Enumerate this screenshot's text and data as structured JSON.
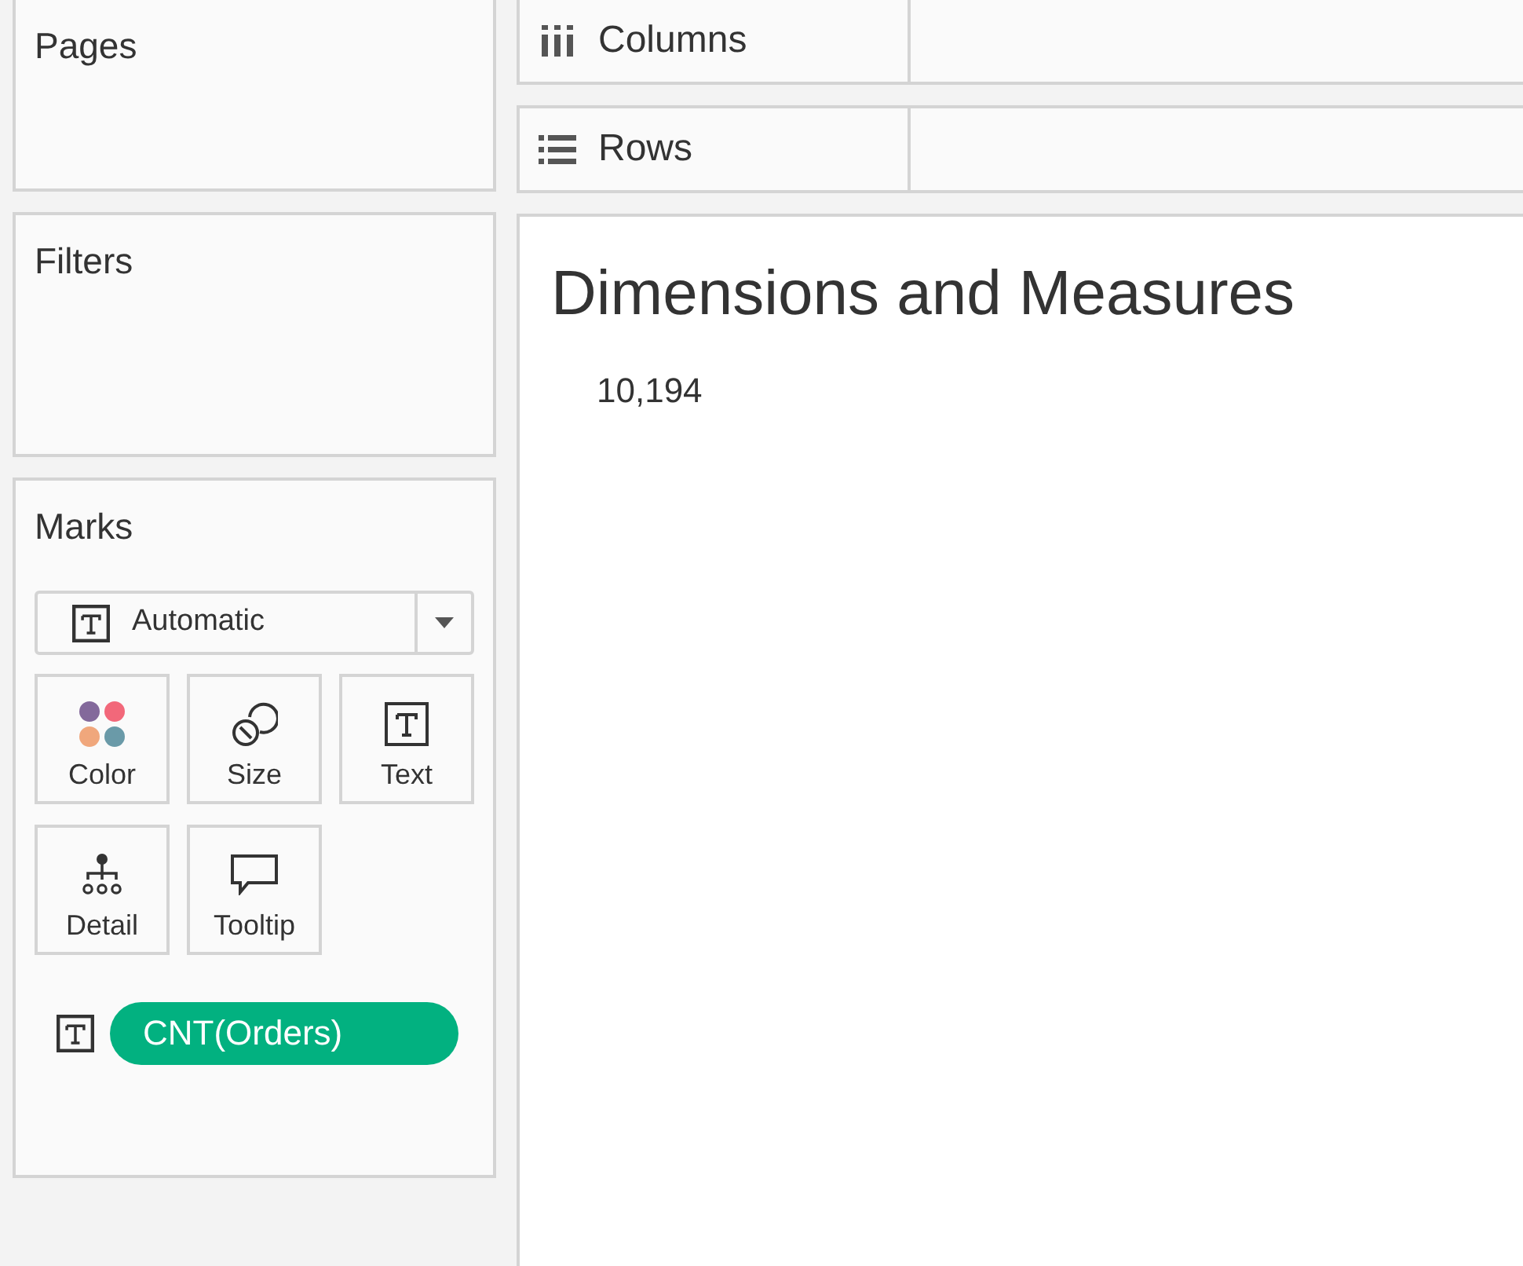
{
  "pages_card": {
    "title": "Pages"
  },
  "filters_card": {
    "title": "Filters"
  },
  "marks_card": {
    "title": "Marks",
    "mark_type": {
      "label": "Automatic",
      "kind": "text"
    },
    "buttons": [
      {
        "label": "Color",
        "kind": "color"
      },
      {
        "label": "Size",
        "kind": "size"
      },
      {
        "label": "Text",
        "kind": "text"
      },
      {
        "label": "Detail",
        "kind": "detail"
      },
      {
        "label": "Tooltip",
        "kind": "tooltip"
      }
    ],
    "fields": [
      {
        "label": "CNT(Orders)",
        "kind": "text"
      }
    ]
  },
  "shelves": [
    {
      "label": "Columns",
      "kind": "columns"
    },
    {
      "label": "Rows",
      "kind": "rows"
    }
  ],
  "view": {
    "title": "Dimensions and Measures",
    "value": "10,194"
  }
}
